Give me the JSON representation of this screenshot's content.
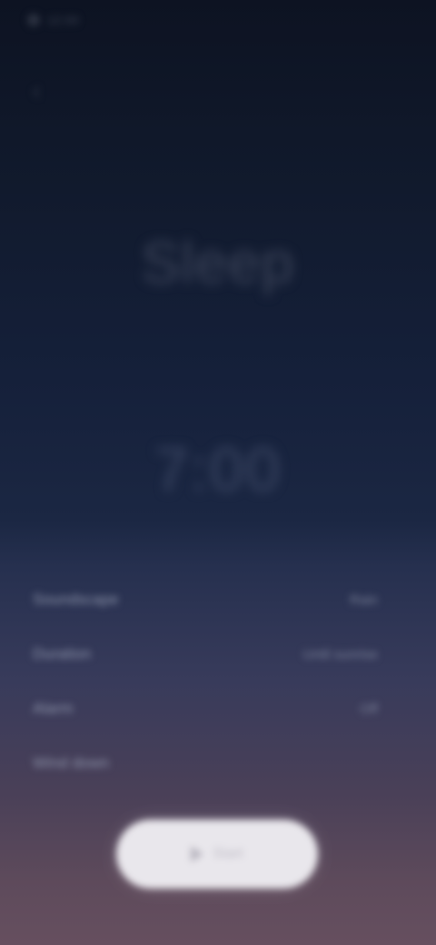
{
  "status_bar": {
    "time": "12:00"
  },
  "header": {
    "back_icon": "chevron-left-icon"
  },
  "main": {
    "title": "Sleep",
    "timer": "7:00"
  },
  "settings": [
    {
      "label": "Soundscape",
      "value": "Rain"
    },
    {
      "label": "Duration",
      "value": "Until sunrise"
    },
    {
      "label": "Alarm",
      "value": "Off"
    },
    {
      "label": "Wind down",
      "value": ""
    }
  ],
  "action": {
    "start_label": "Start",
    "icon": "play-icon"
  }
}
